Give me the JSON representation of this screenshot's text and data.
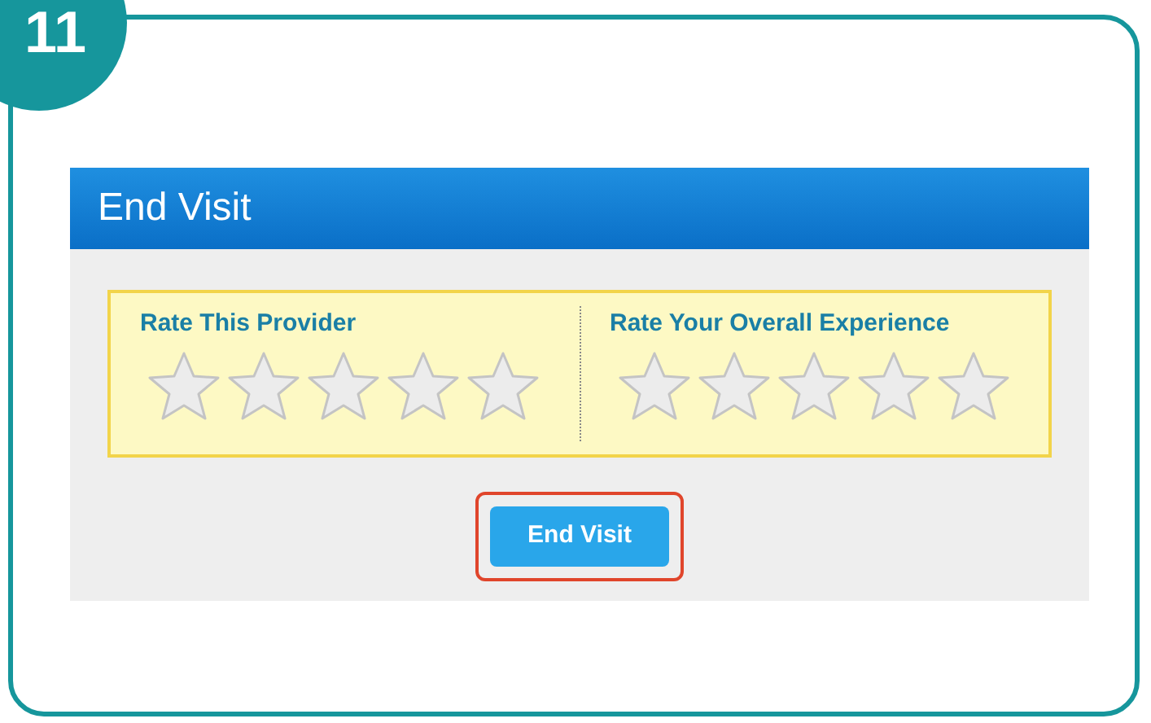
{
  "step_badge": "11",
  "dialog": {
    "title": "End Visit",
    "ratings": [
      {
        "label": "Rate This Provider",
        "stars": 0
      },
      {
        "label": "Rate Your Overall Experience",
        "stars": 0
      }
    ],
    "button": {
      "label": "End Visit",
      "highlighted": true
    }
  }
}
